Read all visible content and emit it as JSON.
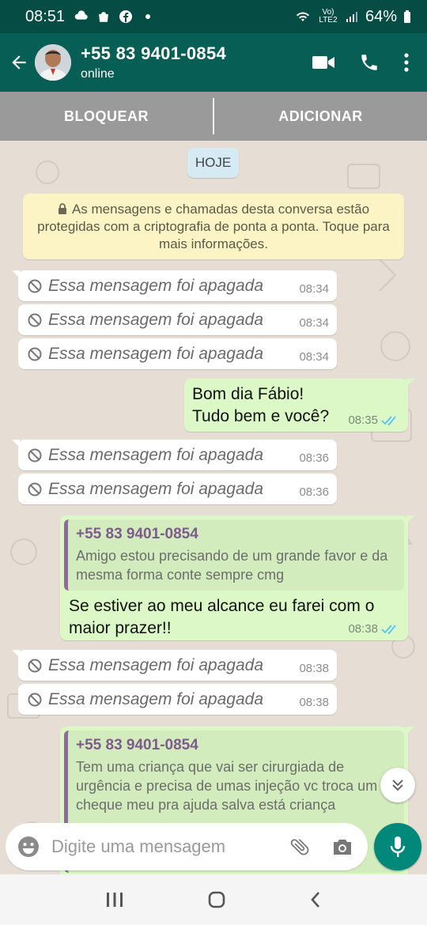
{
  "status_bar": {
    "time": "08:51",
    "network": "Vo) LTE2",
    "battery": "64%"
  },
  "header": {
    "contact": "+55 83 9401-0854",
    "status": "online"
  },
  "action_bar": {
    "block_label": "BLOQUEAR",
    "add_label": "ADICIONAR"
  },
  "chat": {
    "day_label": "HOJE",
    "encryption_notice": "As mensagens e chamadas desta conversa estão protegidas com a criptografia de ponta a ponta. Toque para mais informações.",
    "deleted_text": "Essa mensagem foi apagada",
    "messages": [
      {
        "type": "deleted",
        "time": "08:34"
      },
      {
        "type": "deleted",
        "time": "08:34"
      },
      {
        "type": "deleted",
        "time": "08:34"
      },
      {
        "type": "outgoing",
        "lines": [
          "Bom dia Fábio!",
          "Tudo bem e você?"
        ],
        "time": "08:35"
      },
      {
        "type": "deleted",
        "time": "08:36"
      },
      {
        "type": "deleted",
        "time": "08:36"
      },
      {
        "type": "outgoing_reply",
        "quote_name": "+55 83 9401-0854",
        "quote_text": "Amigo estou precisando de um grande favor e da mesma forma conte sempre cmg",
        "text": "Se estiver ao meu alcance eu farei com o maior prazer!!",
        "time": "08:38"
      },
      {
        "type": "deleted",
        "time": "08:38"
      },
      {
        "type": "deleted",
        "time": "08:38"
      },
      {
        "type": "outgoing_reply",
        "quote_name": "+55 83 9401-0854",
        "quote_text": "Tem uma criança que vai ser cirurgiada de urgência e precisa de umas injeção vc troca um cheque meu pra ajuda salva está criança"
      }
    ]
  },
  "composer": {
    "placeholder": "Digite uma mensagem"
  },
  "colors": {
    "header": "#075e54",
    "status_bar": "#054d44",
    "outgoing_bubble": "#dcf8c6",
    "incoming_bubble": "#ffffff",
    "accent": "#00897b",
    "read_ticks": "#4fc3f7"
  }
}
